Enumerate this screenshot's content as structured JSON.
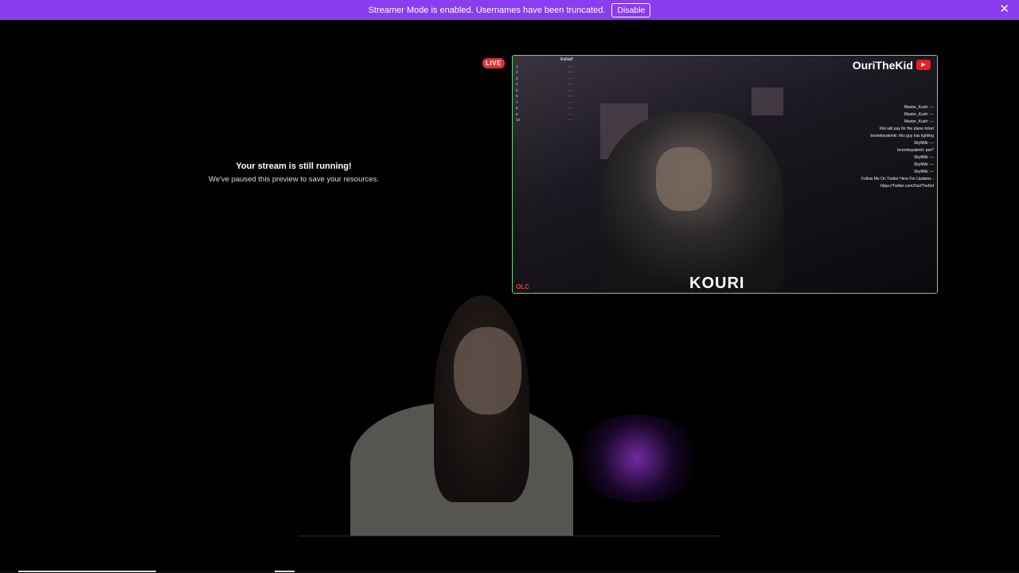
{
  "banner": {
    "message": "Streamer Mode is enabled. Usernames have been truncated.",
    "disable_label": "Disable",
    "close_glyph": "✕",
    "color": "#8a3cf0"
  },
  "preview": {
    "paused_title": "Your stream is still running!",
    "paused_subtitle": "We've paused this preview to save your resources."
  },
  "live_badge": "LIVE",
  "overlay": {
    "stream_name": "OuriTheKid",
    "logo_text": "KOURI",
    "corner_tag": "OLC",
    "chat_lines": [
      "Master_Kush: —",
      "Master_Kush: —",
      "Master_Kush: —",
      "Kiki will pay for the plane ticket",
      "boomtwyakinki: this guy has lighting",
      "SkyMilk: —",
      "boomtwyakinki: pen*",
      "SkyMilk: —",
      "SkyMilk: —",
      "SkyMilk: —",
      "Follow Me On Twitter Here For Updates -",
      "https://Twitter.com/OuriTheKid"
    ],
    "leaderboard_title": "RaNaP",
    "leaderboard": [
      "1",
      "2",
      "3",
      "4",
      "5",
      "6",
      "7",
      "8",
      "9",
      "10"
    ]
  }
}
